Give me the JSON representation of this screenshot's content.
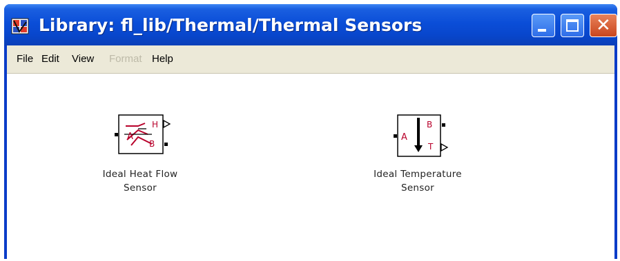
{
  "window": {
    "title": "Library: fl_lib/Thermal/Thermal Sensors",
    "controls": [
      "minimize",
      "maximize",
      "close"
    ]
  },
  "menubar": {
    "items": [
      {
        "label": "File",
        "enabled": true
      },
      {
        "label": "Edit",
        "enabled": true
      },
      {
        "label": "View",
        "enabled": true
      },
      {
        "label": "Format",
        "enabled": false
      },
      {
        "label": "Help",
        "enabled": true
      }
    ]
  },
  "blocks": [
    {
      "icon": "heat-flow-sensor-icon",
      "ports": [
        "A",
        "B",
        "H"
      ],
      "label_line1": "Ideal Heat Flow",
      "label_line2": "Sensor"
    },
    {
      "icon": "temperature-sensor-icon",
      "ports": [
        "A",
        "B",
        "T"
      ],
      "label_line1": "Ideal Temperature",
      "label_line2": "Sensor"
    }
  ],
  "colors": {
    "titlebar": "#0b4ed8",
    "menubar": "#ece9d8",
    "port_label": "#b8002a",
    "close_button": "#c8461e"
  }
}
